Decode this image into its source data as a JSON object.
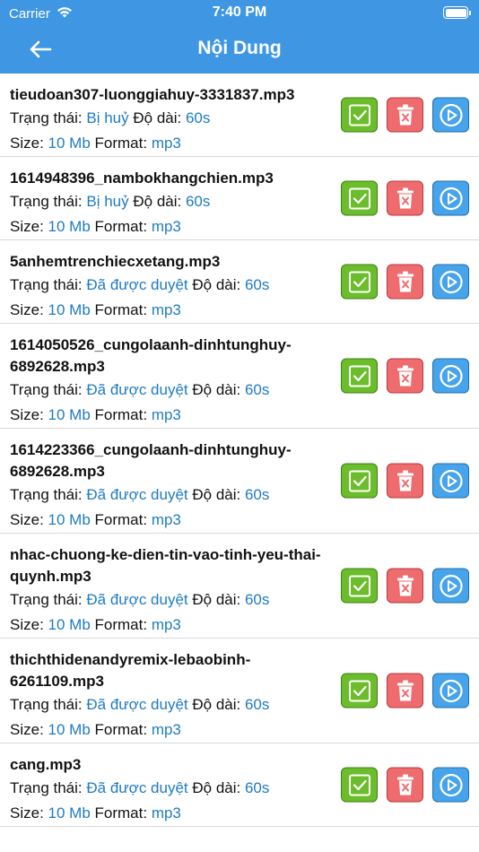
{
  "status_bar": {
    "carrier": "Carrier",
    "time": "7:40 PM"
  },
  "navbar": {
    "title": "Nội Dung"
  },
  "labels": {
    "status": "Trạng thái:",
    "duration": "Độ dài:",
    "size": "Size:",
    "format": "Format:"
  },
  "colors": {
    "header": "#3f97e4",
    "value": "#1f7bc2",
    "approve": "#6cbd2b",
    "delete": "#ee6b6e",
    "play": "#47a3ea"
  },
  "items": [
    {
      "name": "tieudoan307-luonggiahuy-3331837.mp3",
      "status": "Bị huỷ",
      "duration": "60s",
      "size": "10 Mb",
      "format": "mp3"
    },
    {
      "name": "1614948396_nambokhangchien.mp3",
      "status": "Bị huỷ",
      "duration": "60s",
      "size": "10 Mb",
      "format": "mp3"
    },
    {
      "name": "5anhemtrenchiecxetang.mp3",
      "status": "Đã được duyệt",
      "duration": "60s",
      "size": "10 Mb",
      "format": "mp3"
    },
    {
      "name": "1614050526_cungolaanh-dinhtunghuy-6892628.mp3",
      "status": "Đã được duyệt",
      "duration": "60s",
      "size": "10 Mb",
      "format": "mp3"
    },
    {
      "name": "1614223366_cungolaanh-dinhtunghuy-6892628.mp3",
      "status": "Đã được duyệt",
      "duration": "60s",
      "size": "10 Mb",
      "format": "mp3"
    },
    {
      "name": "nhac-chuong-ke-dien-tin-vao-tinh-yeu-thai-quynh.mp3",
      "status": "Đã được duyệt",
      "duration": "60s",
      "size": "10 Mb",
      "format": "mp3"
    },
    {
      "name": "thichthidenandyremix-lebaobinh-6261109.mp3",
      "status": "Đã được duyệt",
      "duration": "60s",
      "size": "10 Mb",
      "format": "mp3"
    },
    {
      "name": "cang.mp3",
      "status": "Đã được duyệt",
      "duration": "60s",
      "size": "10 Mb",
      "format": "mp3"
    }
  ]
}
